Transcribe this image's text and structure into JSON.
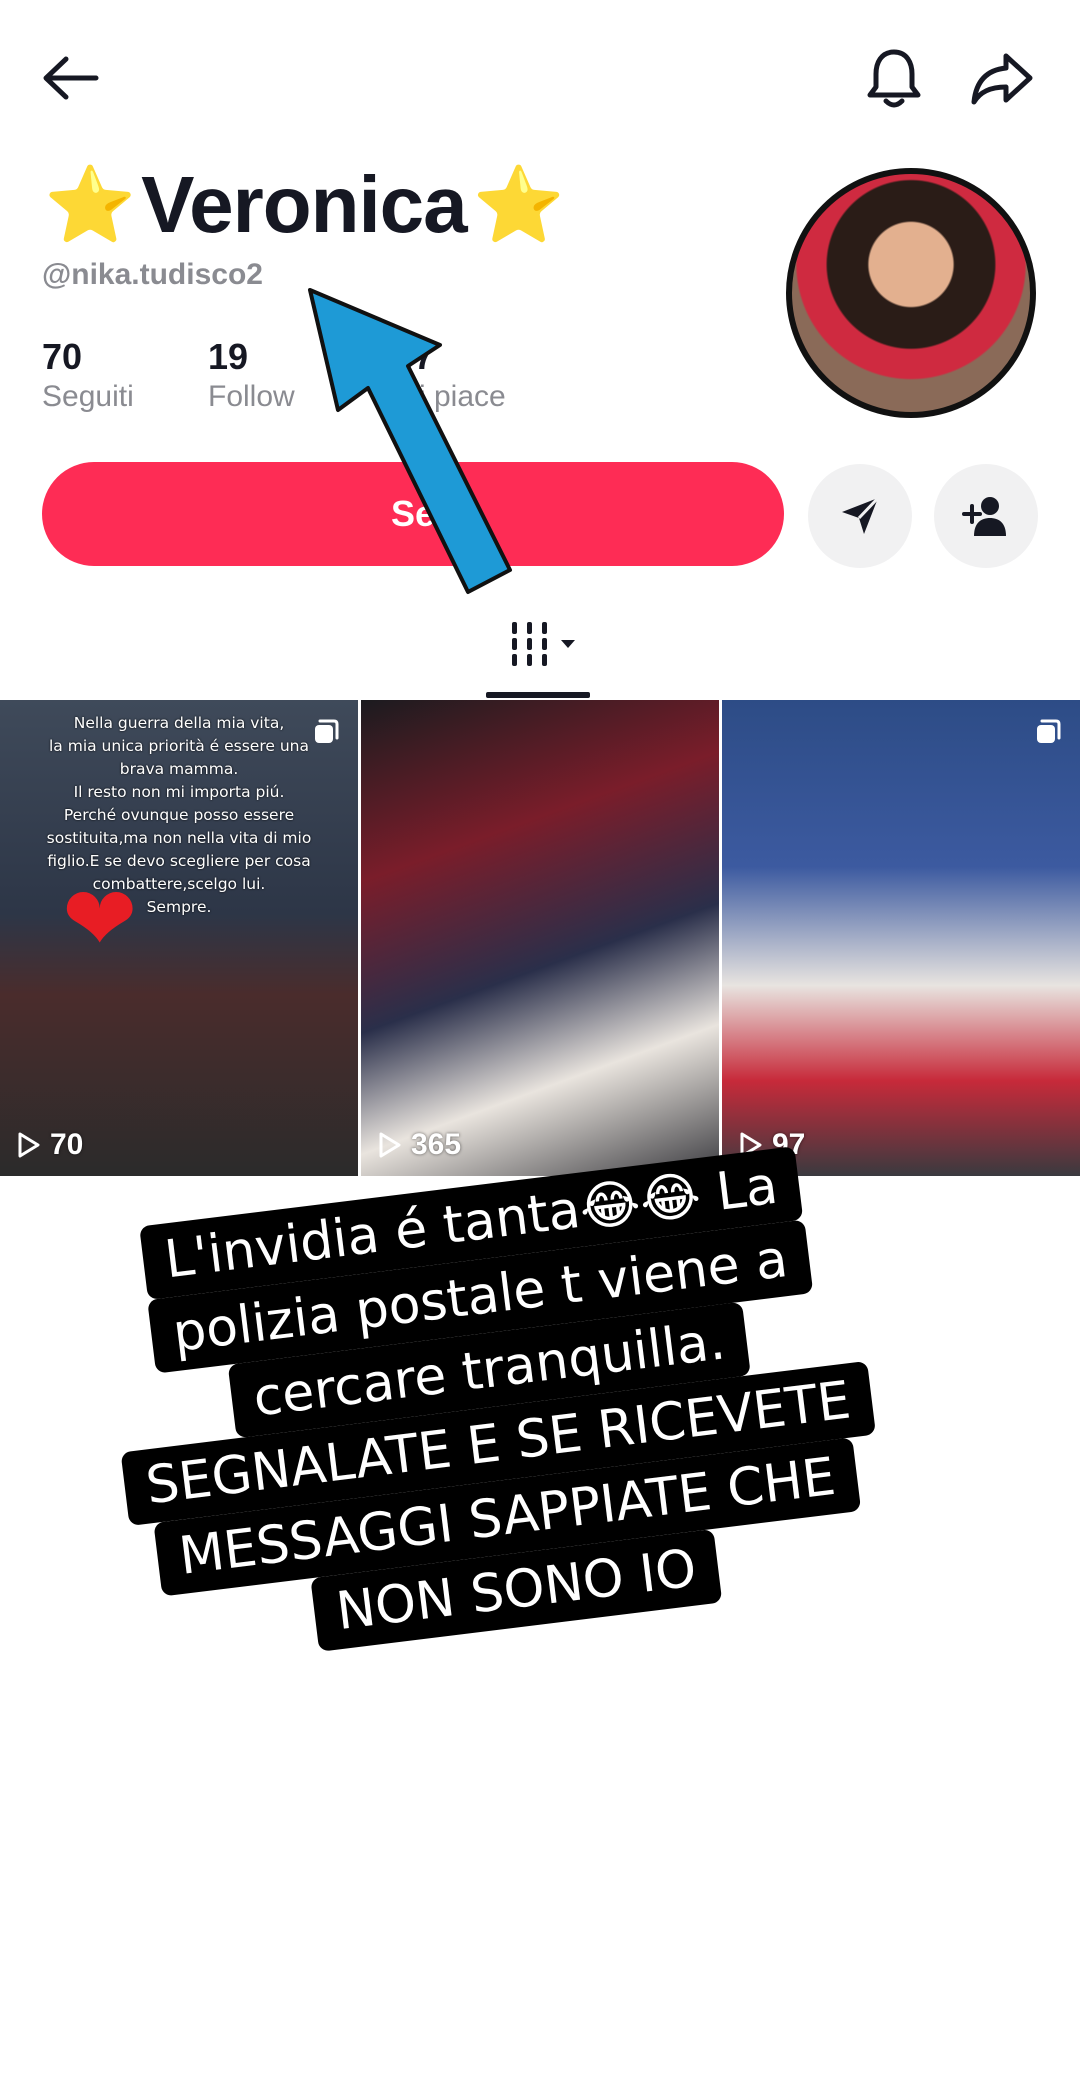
{
  "header": {
    "back_icon": "arrow-left-icon",
    "bell_icon": "bell-icon",
    "share_icon": "share-arrow-icon"
  },
  "profile": {
    "star_left": "⭐",
    "name": "Veronica",
    "star_right": "⭐",
    "handle": "@nika.tudisco2",
    "stats": [
      {
        "value": "70",
        "label": "Seguiti"
      },
      {
        "value": "19",
        "label": "Follow"
      },
      {
        "value": "57",
        "label": "Mi piace"
      }
    ],
    "follow_label": "Se",
    "message_icon": "send-icon",
    "add_friend_icon": "person-add-icon"
  },
  "tabs": {
    "grid_icon": "videos-grid-icon",
    "dropdown_icon": "caret-down-icon"
  },
  "videos": [
    {
      "overlay_text": "Nella guerra della mia vita,\nla mia unica priorità é essere una\nbrava mamma.\nIl resto non mi importa piú.\nPerché ovunque posso essere\nsostituita,ma non nella vita di mio\nfiglio.E se devo scegliere per cosa\ncombattere,scelgo lui.\nSempre.",
      "views": "70"
    },
    {
      "overlay_text": "",
      "views": "365"
    },
    {
      "overlay_text": "",
      "views": "97"
    }
  ],
  "caption": {
    "line1": "L'invidia é tanta😂😂  La",
    "line2": "polizia postale t viene a",
    "line3": "cercare tranquilla.",
    "line4": "SEGNALATE  E SE RICEVETE",
    "line5": "MESSAGGI SAPPIATE CHE",
    "line6": "NON SONO IO"
  },
  "colors": {
    "accent": "#fe2c55",
    "annotation_arrow": "#1e9ad6",
    "text_primary": "#161823",
    "text_secondary": "#8a8b91"
  }
}
